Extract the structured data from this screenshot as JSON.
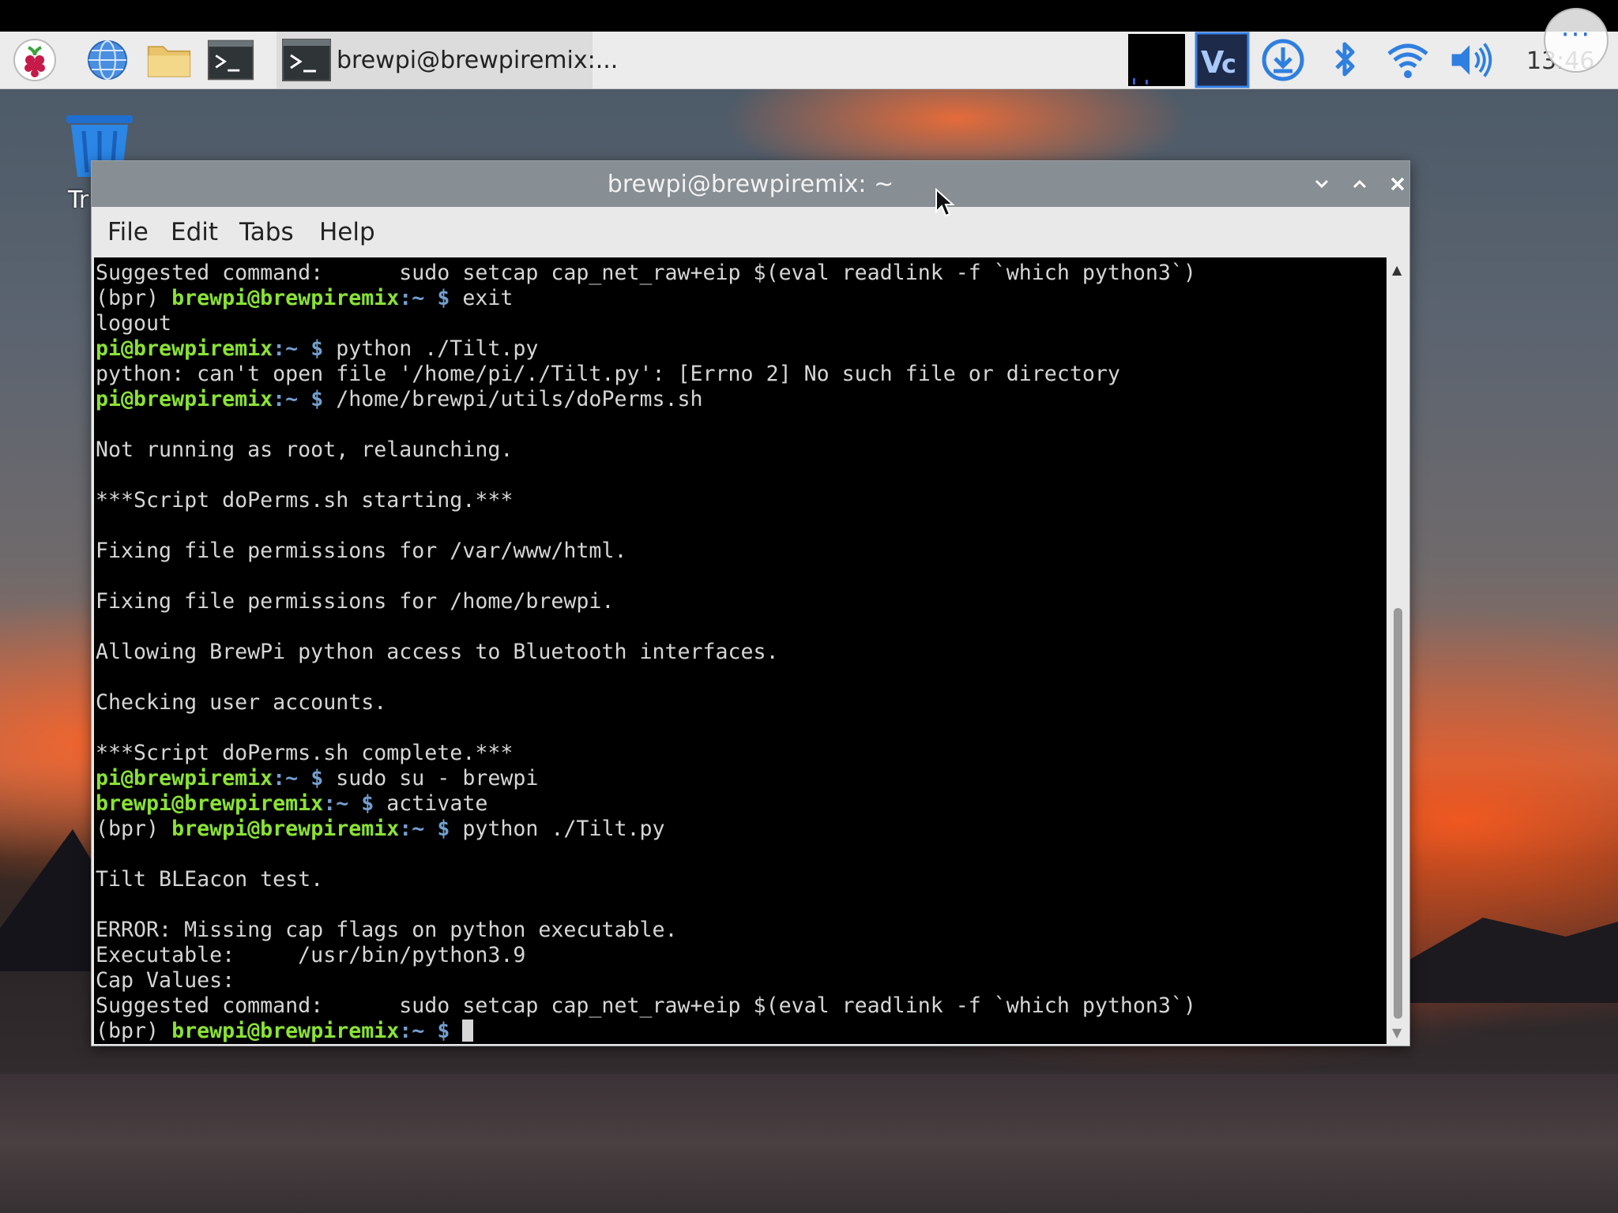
{
  "taskbar": {
    "menu_icon": "raspberry-icon",
    "browser_icon": "globe-icon",
    "files_icon": "folder-icon",
    "terminal_icon": "terminal-icon",
    "task_label": "brewpi@brewpiremix:...",
    "tray": {
      "cpu_monitor": "cpu-monitor-icon",
      "vnc": "vnc-icon",
      "updater": "download-icon",
      "bluetooth": "bluetooth-icon",
      "wifi": "wifi-icon",
      "volume": "volume-icon"
    },
    "clock": "13:46",
    "more_label": "···"
  },
  "desktop": {
    "trash_label": "Tr"
  },
  "window": {
    "title": "brewpi@brewpiremix: ~",
    "menu": [
      "File",
      "Edit",
      "Tabs",
      "Help"
    ]
  },
  "terminal": {
    "lines": [
      [
        {
          "t": "Suggested command:      sudo setcap cap_net_raw+eip $(eval readlink -f `which python3`)"
        }
      ],
      [
        {
          "t": "(bpr) "
        },
        {
          "t": "brewpi@brewpiremix",
          "c": "p-bold"
        },
        {
          "t": ":~ $",
          "c": "p-blue"
        },
        {
          "t": " exit"
        }
      ],
      [
        {
          "t": "logout"
        }
      ],
      [
        {
          "t": "pi@brewpiremix",
          "c": "p-bold"
        },
        {
          "t": ":~ $",
          "c": "p-blue"
        },
        {
          "t": " python ./Tilt.py"
        }
      ],
      [
        {
          "t": "python: can't open file '/home/pi/./Tilt.py': [Errno 2] No such file or directory"
        }
      ],
      [
        {
          "t": "pi@brewpiremix",
          "c": "p-bold"
        },
        {
          "t": ":~ $",
          "c": "p-blue"
        },
        {
          "t": " /home/brewpi/utils/doPerms.sh"
        }
      ],
      [
        {
          "t": ""
        }
      ],
      [
        {
          "t": "Not running as root, relaunching."
        }
      ],
      [
        {
          "t": ""
        }
      ],
      [
        {
          "t": "***Script doPerms.sh starting.***"
        }
      ],
      [
        {
          "t": ""
        }
      ],
      [
        {
          "t": "Fixing file permissions for /var/www/html."
        }
      ],
      [
        {
          "t": ""
        }
      ],
      [
        {
          "t": "Fixing file permissions for /home/brewpi."
        }
      ],
      [
        {
          "t": ""
        }
      ],
      [
        {
          "t": "Allowing BrewPi python access to Bluetooth interfaces."
        }
      ],
      [
        {
          "t": ""
        }
      ],
      [
        {
          "t": "Checking user accounts."
        }
      ],
      [
        {
          "t": ""
        }
      ],
      [
        {
          "t": "***Script doPerms.sh complete.***"
        }
      ],
      [
        {
          "t": "pi@brewpiremix",
          "c": "p-bold"
        },
        {
          "t": ":~ $",
          "c": "p-blue"
        },
        {
          "t": " sudo su - brewpi"
        }
      ],
      [
        {
          "t": "brewpi@brewpiremix",
          "c": "p-bold"
        },
        {
          "t": ":~ $",
          "c": "p-blue"
        },
        {
          "t": " activate"
        }
      ],
      [
        {
          "t": "(bpr) "
        },
        {
          "t": "brewpi@brewpiremix",
          "c": "p-bold"
        },
        {
          "t": ":~ $",
          "c": "p-blue"
        },
        {
          "t": " python ./Tilt.py"
        }
      ],
      [
        {
          "t": ""
        }
      ],
      [
        {
          "t": "Tilt BLEacon test."
        }
      ],
      [
        {
          "t": ""
        }
      ],
      [
        {
          "t": "ERROR: Missing cap flags on python executable."
        }
      ],
      [
        {
          "t": "Executable:     /usr/bin/python3.9"
        }
      ],
      [
        {
          "t": "Cap Values:"
        }
      ],
      [
        {
          "t": "Suggested command:      sudo setcap cap_net_raw+eip $(eval readlink -f `which python3`)"
        }
      ],
      [
        {
          "t": "(bpr) "
        },
        {
          "t": "brewpi@brewpiremix",
          "c": "p-bold"
        },
        {
          "t": ":~ $",
          "c": "p-blue"
        },
        {
          "t": " "
        }
      ]
    ]
  },
  "colors": {
    "prompt_user": "#8ae234",
    "prompt_path": "#729fcf",
    "terminal_bg": "#000000",
    "titlebar_bg": "#878e94"
  }
}
